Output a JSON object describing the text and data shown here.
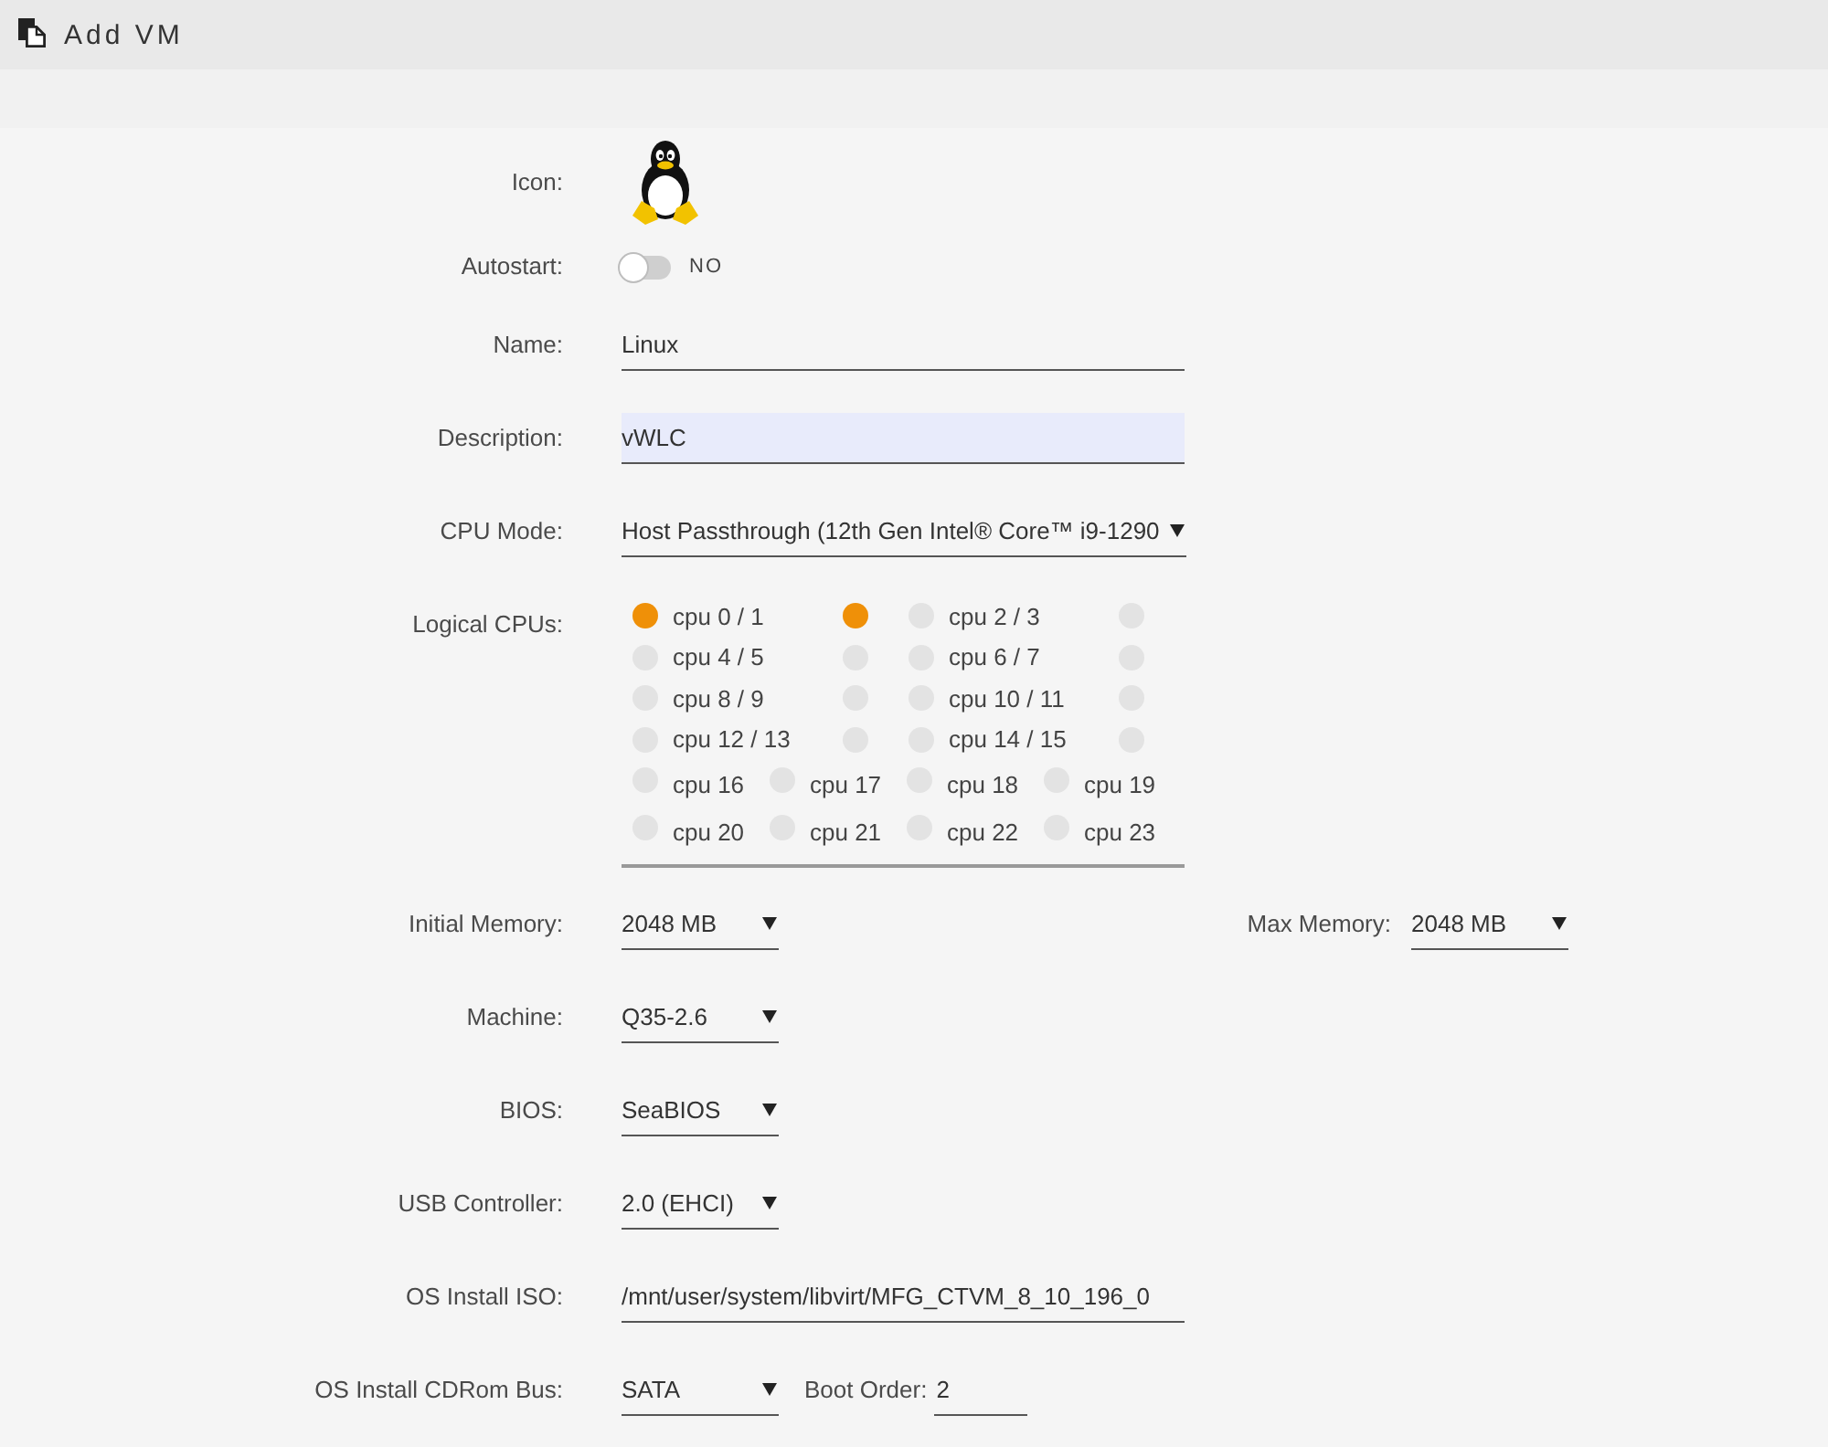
{
  "header": {
    "title": "Add VM"
  },
  "rows": [
    {
      "kind": "icon",
      "label": "Icon:"
    },
    {
      "kind": "toggle",
      "label": "Autostart:",
      "on": false,
      "state_text": "NO"
    },
    {
      "kind": "text",
      "label": "Name:",
      "value": "Linux",
      "focused": false
    },
    {
      "kind": "text",
      "label": "Description:",
      "value": "vWLC",
      "focused": true
    },
    {
      "kind": "select",
      "label": "CPU Mode:",
      "value": "Host Passthrough (12th Gen Intel® Core™ i9-1290"
    },
    {
      "kind": "cpus",
      "label": "Logical CPUs:",
      "cpus": [
        {
          "kind": "pair",
          "label": "cpu 0 / 1",
          "threads": [
            {
              "selected": true
            },
            {
              "selected": true
            }
          ]
        },
        {
          "kind": "pair",
          "label": "cpu 2 / 3",
          "threads": [
            {
              "selected": false
            },
            {
              "selected": false
            }
          ]
        },
        {
          "kind": "pair",
          "label": "cpu 4 / 5",
          "threads": [
            {
              "selected": false
            },
            {
              "selected": false
            }
          ]
        },
        {
          "kind": "pair",
          "label": "cpu 6 / 7",
          "threads": [
            {
              "selected": false
            },
            {
              "selected": false
            }
          ]
        },
        {
          "kind": "pair",
          "label": "cpu 8 / 9",
          "threads": [
            {
              "selected": false
            },
            {
              "selected": false
            }
          ]
        },
        {
          "kind": "pair",
          "label": "cpu 10 / 11",
          "threads": [
            {
              "selected": false
            },
            {
              "selected": false
            }
          ]
        },
        {
          "kind": "pair",
          "label": "cpu 12 / 13",
          "threads": [
            {
              "selected": false
            },
            {
              "selected": false
            }
          ]
        },
        {
          "kind": "pair",
          "label": "cpu 14 / 15",
          "threads": [
            {
              "selected": false
            },
            {
              "selected": false
            }
          ]
        },
        {
          "kind": "single",
          "label": "cpu 16",
          "threads": [
            {
              "selected": false
            }
          ]
        },
        {
          "kind": "single",
          "label": "cpu 17",
          "threads": [
            {
              "selected": false
            }
          ]
        },
        {
          "kind": "single",
          "label": "cpu 18",
          "threads": [
            {
              "selected": false
            }
          ]
        },
        {
          "kind": "single",
          "label": "cpu 19",
          "threads": [
            {
              "selected": false
            }
          ]
        },
        {
          "kind": "single",
          "label": "cpu 20",
          "threads": [
            {
              "selected": false
            }
          ]
        },
        {
          "kind": "single",
          "label": "cpu 21",
          "threads": [
            {
              "selected": false
            }
          ]
        },
        {
          "kind": "single",
          "label": "cpu 22",
          "threads": [
            {
              "selected": false
            }
          ]
        },
        {
          "kind": "single",
          "label": "cpu 23",
          "threads": [
            {
              "selected": false
            }
          ]
        }
      ]
    },
    {
      "kind": "select",
      "label": "Initial Memory:",
      "value": "2048 MB",
      "extra": {
        "kind": "select",
        "label": "Max Memory:",
        "value": "2048 MB"
      }
    },
    {
      "kind": "select",
      "label": "Machine:",
      "value": "Q35-2.6"
    },
    {
      "kind": "select",
      "label": "BIOS:",
      "value": "SeaBIOS"
    },
    {
      "kind": "select",
      "label": "USB Controller:",
      "value": "2.0 (EHCI)"
    },
    {
      "kind": "text",
      "label": "OS Install ISO:",
      "value": "/mnt/user/system/libvirt/MFG_CTVM_8_10_196_0",
      "focused": false
    },
    {
      "kind": "select",
      "label": "OS Install CDRom Bus:",
      "value": "SATA",
      "extra": {
        "kind": "text",
        "label": "Boot Order:",
        "value": "2"
      }
    }
  ]
}
